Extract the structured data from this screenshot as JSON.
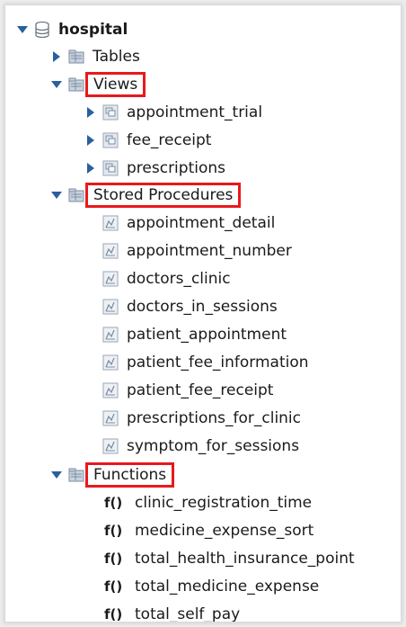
{
  "tree": {
    "database": {
      "label": "hospital",
      "icon": "database-icon",
      "expanded": true
    },
    "groups": {
      "tables": {
        "label": "Tables",
        "expanded": false
      },
      "views": {
        "label": "Views",
        "expanded": true,
        "items": [
          "appointment_trial",
          "fee_receipt",
          "prescriptions"
        ]
      },
      "stored_procedures": {
        "label": "Stored Procedures",
        "expanded": true,
        "items": [
          "appointment_detail",
          "appointment_number",
          "doctors_clinic",
          "doctors_in_sessions",
          "patient_appointment",
          "patient_fee_information",
          "patient_fee_receipt",
          "prescriptions_for_clinic",
          "symptom_for_sessions"
        ]
      },
      "functions": {
        "label": "Functions",
        "expanded": true,
        "icon_text": "f()",
        "items": [
          "clinic_registration_time",
          "medicine_expense_sort",
          "total_health_insurance_point",
          "total_medicine_expense",
          "total_self_pay"
        ]
      }
    }
  },
  "colors": {
    "highlight_box": "#e8191c",
    "arrow": "#2b5f9e",
    "folder": "#8a9bb0"
  }
}
